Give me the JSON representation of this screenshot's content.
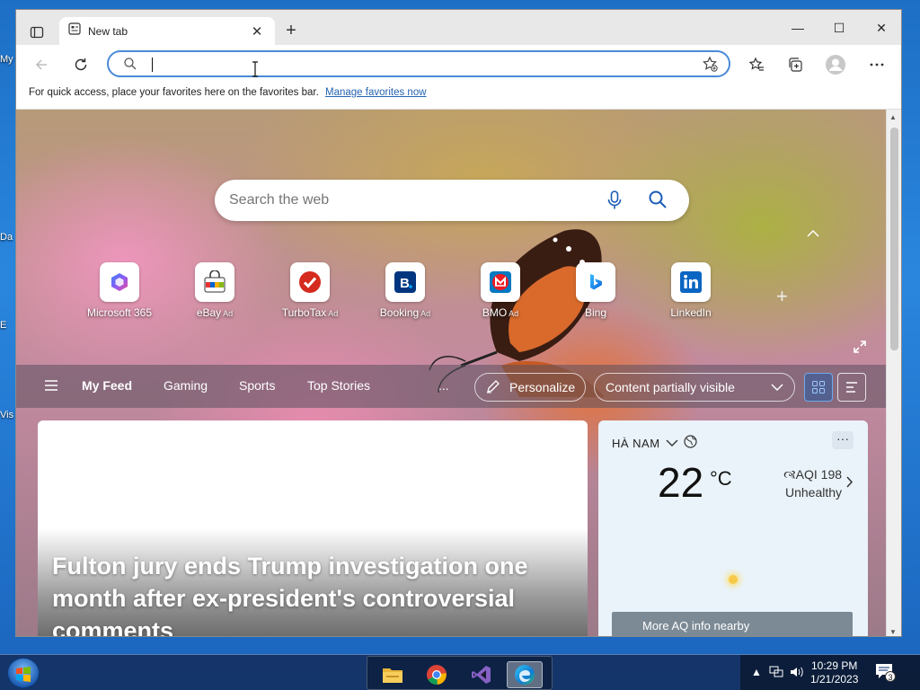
{
  "desktop": {
    "labels": [
      "My",
      "Da",
      "E",
      "Vis"
    ]
  },
  "browser": {
    "tab_title": "New tab",
    "address_value": "",
    "favbar_text": "For quick access, place your favorites here on the favorites bar.",
    "favbar_link": "Manage favorites now"
  },
  "ntp": {
    "search_placeholder": "Search the web",
    "quick_links": [
      {
        "label": "Microsoft 365",
        "ad": "",
        "icon": "microsoft-365-icon"
      },
      {
        "label": "eBay",
        "ad": "Ad",
        "icon": "ebay-icon"
      },
      {
        "label": "TurboTax",
        "ad": "Ad",
        "icon": "turbotax-icon"
      },
      {
        "label": "Booking",
        "ad": "Ad",
        "icon": "booking-icon"
      },
      {
        "label": "BMO",
        "ad": "Ad",
        "icon": "bmo-icon"
      },
      {
        "label": "Bing",
        "ad": "",
        "icon": "bing-icon"
      },
      {
        "label": "LinkedIn",
        "ad": "",
        "icon": "linkedin-icon"
      }
    ],
    "feed_tabs": [
      "My Feed",
      "Gaming",
      "Sports",
      "Top Stories"
    ],
    "more_label": "...",
    "personalize_label": "Personalize",
    "content_visibility": "Content partially visible",
    "news": {
      "headline": "Fulton jury ends Trump investigation one month after ex-president's controversial comments"
    },
    "weather": {
      "location": "HÀ NAM",
      "temp": "22",
      "unit": "°C",
      "aqi": "AQI 198",
      "aqi_status": "Unhealthy",
      "button": "More AQ info nearby",
      "more": "···"
    }
  },
  "taskbar": {
    "time": "10:29 PM",
    "date": "1/21/2023",
    "notification_count": "3",
    "apps": [
      "file-explorer-icon",
      "chrome-icon",
      "visual-studio-icon",
      "edge-icon"
    ]
  }
}
